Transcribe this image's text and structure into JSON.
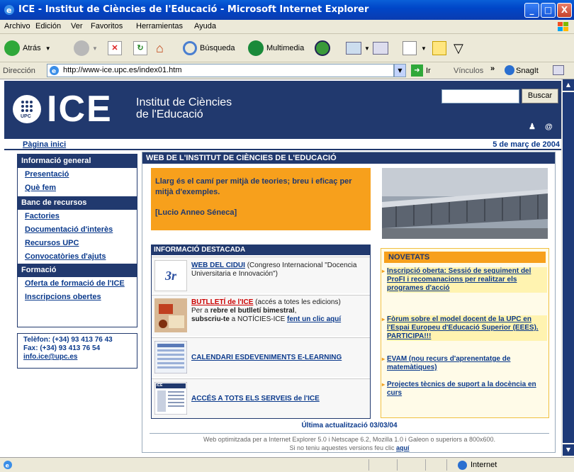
{
  "window": {
    "title": "ICE - Institut de Ciències de l'Educació - Microsoft Internet Explorer",
    "minimize": "_",
    "maximize": "□",
    "close": "X"
  },
  "menu": [
    "Archivo",
    "Edición",
    "Ver",
    "Favoritos",
    "Herramientas",
    "Ayuda"
  ],
  "toolbar": {
    "back": "Atrás",
    "search": "Búsqueda",
    "multimedia": "Multimedia"
  },
  "address": {
    "label": "Dirección",
    "url": "http://www-ice.upc.es/index01.htm",
    "go": "Ir",
    "links": "Vínculos",
    "snagit": "SnagIt"
  },
  "status": {
    "zone": "Internet"
  },
  "site": {
    "logo_small": "UPC",
    "logo": "ICE",
    "name_line1": "Institut de Ciències",
    "name_line2": "de l'Educació",
    "search_button": "Buscar",
    "at": "@",
    "home_link": "Pàgina inici",
    "date": "5 de març de 2004"
  },
  "sidebar": {
    "sections": [
      {
        "title": "Informació general",
        "links": [
          "Presentació",
          "Què fem"
        ]
      },
      {
        "title": "Banc de recursos",
        "links": [
          "Factories",
          "Documentació d'interès",
          "Recursos UPC",
          "Convocatòries d'ajuts"
        ]
      },
      {
        "title": "Formació",
        "links": [
          "Oferta de formació de l'ICE",
          "Inscripcions obertes"
        ]
      }
    ],
    "contact": {
      "phone": "Telèfon: (+34) 93 413 76 43",
      "fax": "Fax: (+34) 93 413 76 54",
      "email": "info.ice@upc.es"
    }
  },
  "main": {
    "header": "WEB DE L'INSTITUT DE CIÈNCIES DE L'EDUCACIÓ",
    "quote": "Llarg és el camí per mitjà de teories; breu i eficaç per mitjà d'exemples.",
    "quote_author": "[Lucio Anneo Séneca]",
    "info_header": "INFORMACIÓ DESTACADA",
    "info": [
      {
        "link": "WEB DEL CIDUI",
        "text": " (Congreso Internacional \"Docencia Universitaria e Innovación\")",
        "thumb_label": "3r"
      },
      {
        "link": "BUTLLETÍ de l'ICE",
        "text1": " (accés a totes les edicions)",
        "text2a": "Per a ",
        "text2b": "rebre el butlletí bimestral",
        "text2c": ",",
        "text3a": "subscriu-te",
        "text3b": " a NOTÍCIES-ICE ",
        "text3c": "fent un clic aquí"
      },
      {
        "link": "CALENDARI ESDEVENIMENTS E-LEARNING"
      },
      {
        "link": "ACCÉS A TOTS ELS SERVEIS de l'ICE",
        "thumb_label": "ICE"
      }
    ],
    "news_header": "NOVETATS",
    "news": [
      "Inscripció oberta: Sessió de seguiment del ProFI i recomanacions per realitzar els programes d'acció",
      "Fòrum sobre el model docent de la UPC en l'Espai Europeu d'Educació Superior (EEES). PARTICIPA!!!",
      "EVAM (nou recurs d'aprenentatge de matemàtiques)",
      "Projectes tècnics de suport a la docència en curs"
    ],
    "last_update": "Última actualització 03/03/04",
    "footer1": "Web optimitzada per a Internet Explorer 5.0 i Netscape 6.2, Mozilla 1.0 i Galeon o superiors a 800x600.",
    "footer2a": "Si no teniu aquestes versions feu clic ",
    "footer2b": "aquí"
  }
}
